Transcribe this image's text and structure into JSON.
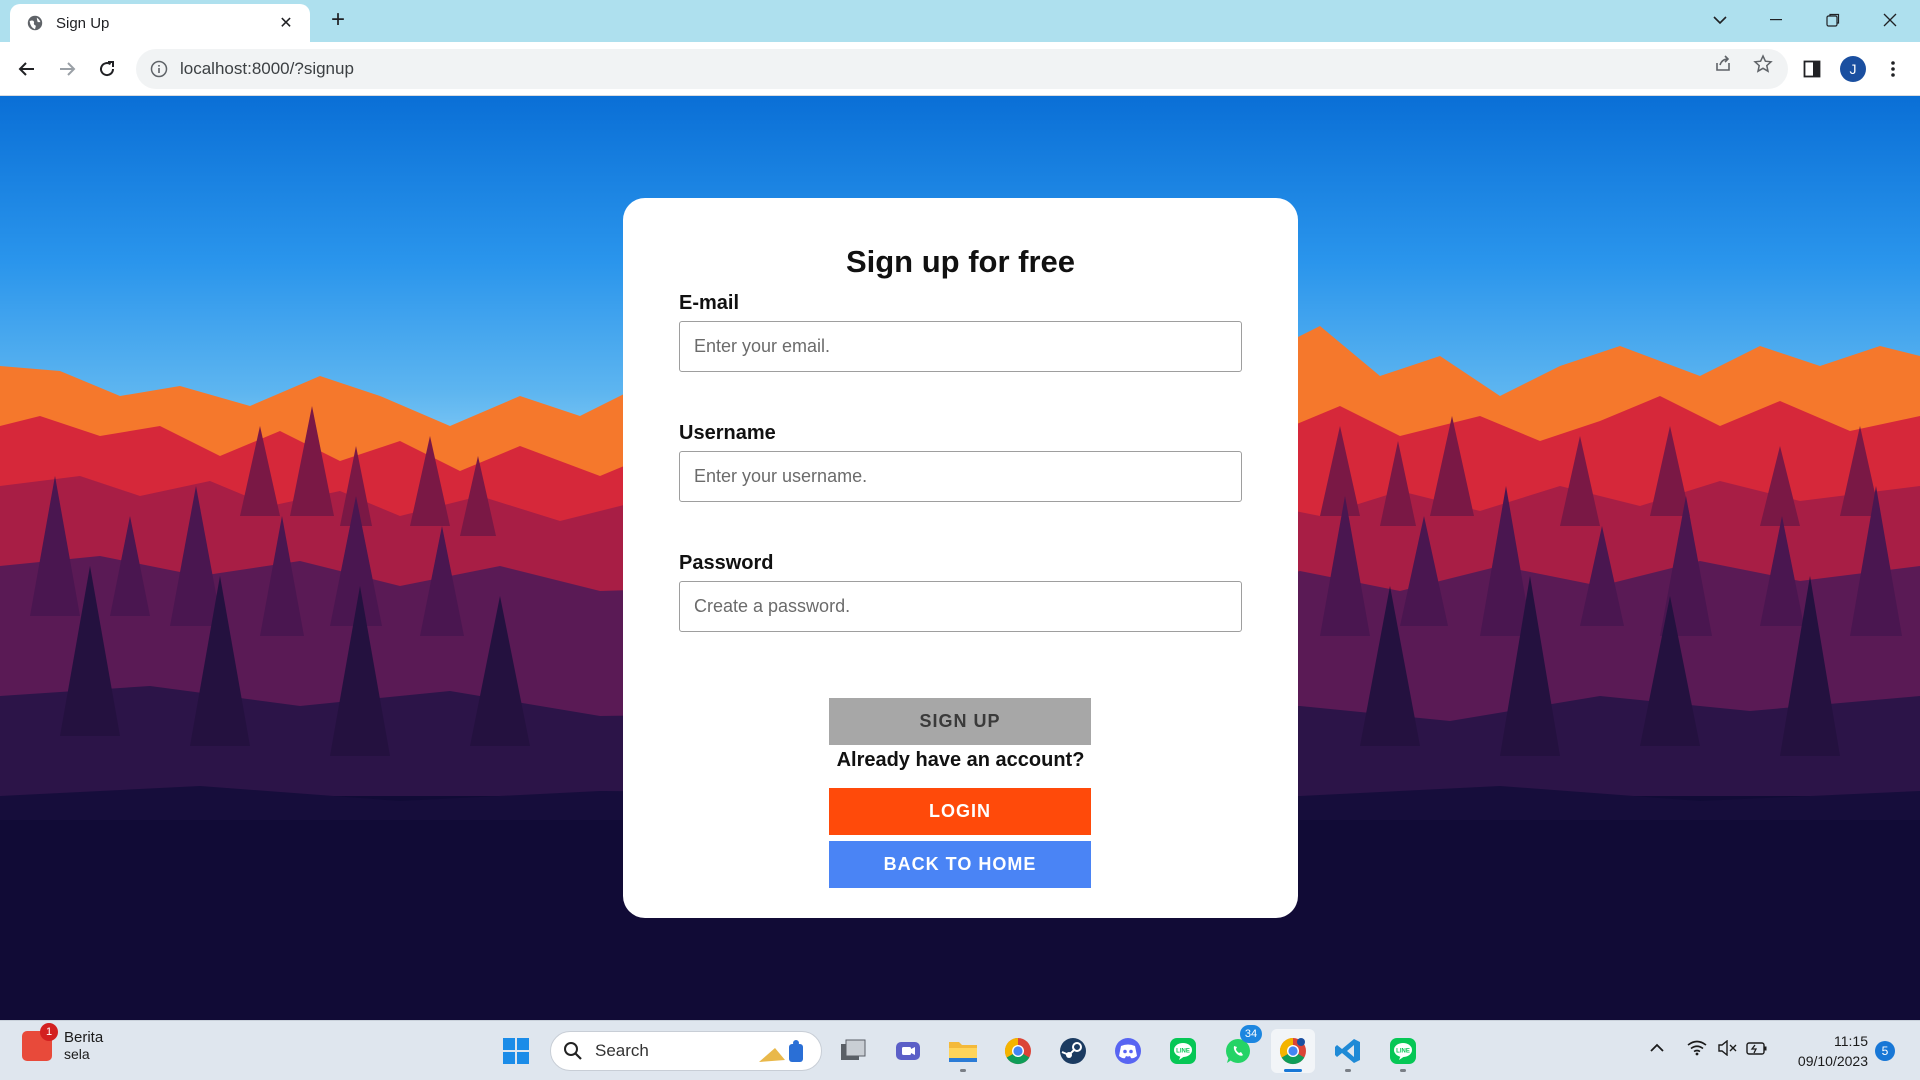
{
  "browser": {
    "tab_title": "Sign Up",
    "url": "localhost:8000/?signup",
    "profile_initial": "J"
  },
  "form": {
    "heading": "Sign up for free",
    "email_label": "E-mail",
    "email_placeholder": "Enter your email.",
    "username_label": "Username",
    "username_placeholder": "Enter your username.",
    "password_label": "Password",
    "password_placeholder": "Create a password.",
    "signup_button": "SIGN UP",
    "already_text": "Already have an account?",
    "login_button": "LOGIN",
    "home_button": "BACK TO HOME"
  },
  "taskbar": {
    "news_badge": "1",
    "news_title": "Berita",
    "news_subtitle": "sela",
    "search_placeholder": "Search",
    "whatsapp_badge": "34",
    "time": "11:15",
    "date": "09/10/2023",
    "notification_count": "5"
  },
  "colors": {
    "login": "#ff4a0a",
    "home": "#4a84f5",
    "signup_disabled": "#a7a7a7"
  }
}
